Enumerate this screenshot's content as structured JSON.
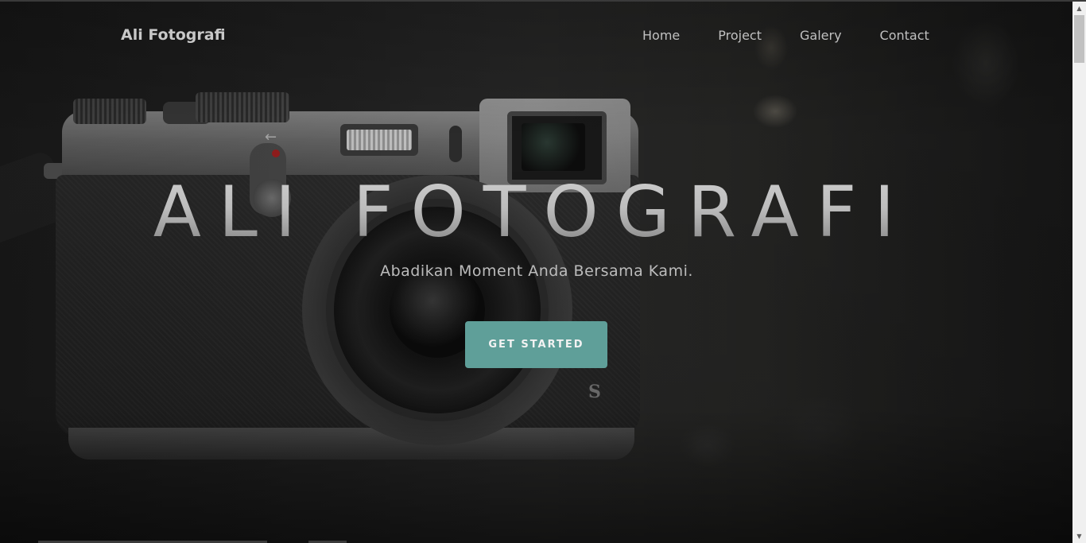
{
  "navbar": {
    "brand": "Ali Fotografi",
    "links": [
      {
        "label": "Home"
      },
      {
        "label": "Project"
      },
      {
        "label": "Galery"
      },
      {
        "label": "Contact"
      }
    ]
  },
  "hero": {
    "title": "ALI FOTOGRAFI",
    "subtitle": "Abadikan Moment Anda Bersama Kami.",
    "cta_label": "GET STARTED"
  },
  "background": {
    "image": "camera-photo",
    "camera_badge": "S"
  },
  "colors": {
    "accent": "#5f9f99",
    "nav_text": "#c0c0c0",
    "background": "#1f1f1f"
  },
  "icons": {
    "scroll_up": "scroll-up-arrow-icon",
    "scroll_down": "scroll-down-arrow-icon"
  }
}
